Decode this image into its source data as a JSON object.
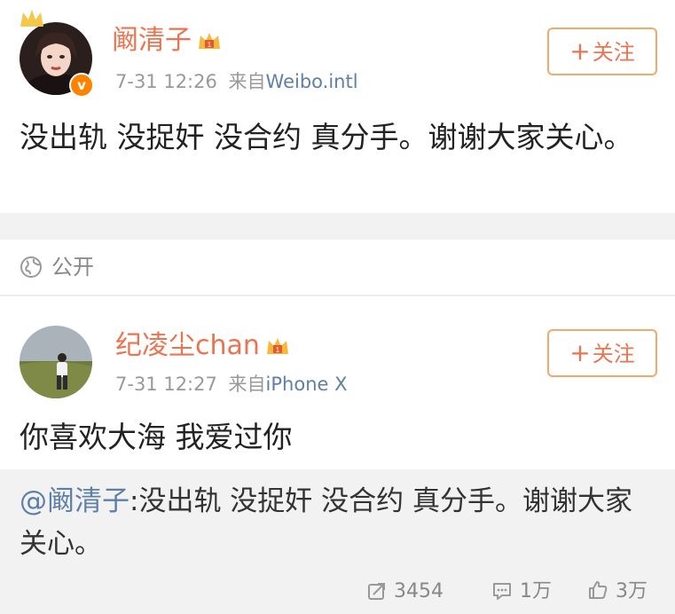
{
  "post1": {
    "username": "阚清子",
    "time": "7-31 12:26",
    "source_prefix": "来自",
    "source": "Weibo.intl",
    "follow_label": "关注",
    "text": "没出轨 没捉奸 没合约 真分手。谢谢大家关心。"
  },
  "visibility": {
    "label": "公开",
    "icon": "globe-icon"
  },
  "post2": {
    "username": "纪凌尘chan",
    "time": "7-31 12:27",
    "source_prefix": "来自",
    "source": "iPhone X",
    "follow_label": "关注",
    "text": "你喜欢大海 我爱过你",
    "repost": {
      "mention": "@阚清子",
      "text": ":没出轨 没捉奸 没合约 真分手。谢谢大家关心。"
    },
    "actions": {
      "repost_count": "3454",
      "comment_count": "1万",
      "like_count": "3万"
    }
  },
  "colors": {
    "username": "#eb7350",
    "link": "#5d7fa8",
    "verified": "#ff8200",
    "follow_border": "#f6a86c"
  }
}
